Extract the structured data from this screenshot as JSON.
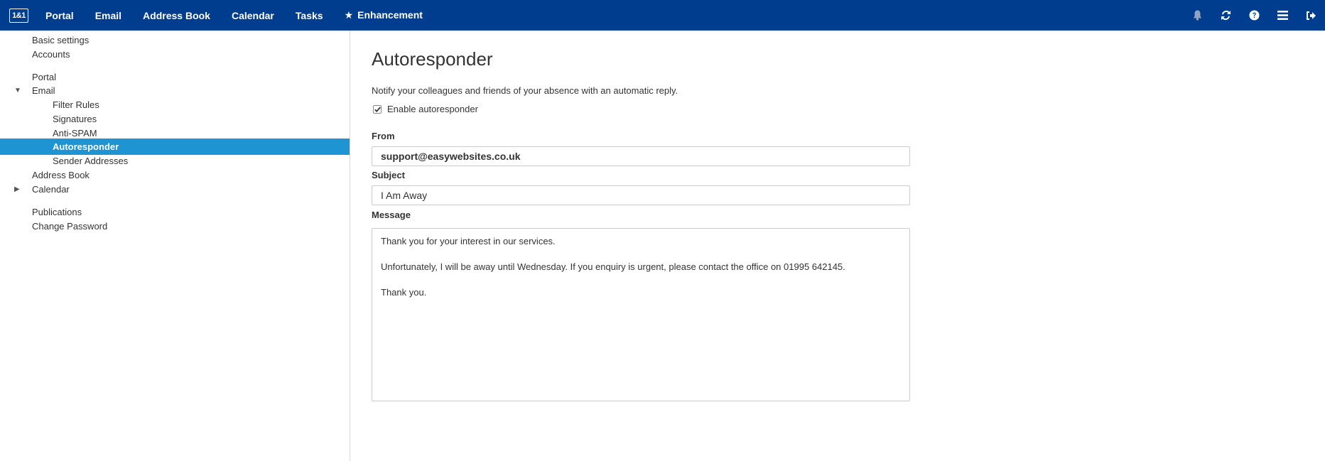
{
  "topbar": {
    "logo_text": "1&1",
    "nav": [
      {
        "label": "Portal"
      },
      {
        "label": "Email"
      },
      {
        "label": "Address Book"
      },
      {
        "label": "Calendar"
      },
      {
        "label": "Tasks"
      },
      {
        "label": "Enhancement",
        "icon": "star-icon"
      }
    ],
    "icons": [
      "bell-icon",
      "refresh-icon",
      "help-icon",
      "menu-icon",
      "logout-icon"
    ],
    "background_color": "#003d8f"
  },
  "sidebar": {
    "items": [
      {
        "label": "Basic settings"
      },
      {
        "label": "Accounts"
      },
      {
        "label": "Portal"
      },
      {
        "label": "Email",
        "expanded": true
      },
      {
        "label": "Filter Rules"
      },
      {
        "label": "Signatures"
      },
      {
        "label": "Anti-SPAM"
      },
      {
        "label": "Autoresponder",
        "active": true
      },
      {
        "label": "Sender Addresses"
      },
      {
        "label": "Address Book"
      },
      {
        "label": "Calendar",
        "expanded": false
      },
      {
        "label": "Publications"
      },
      {
        "label": "Change Password"
      }
    ],
    "active_color": "#1f94d2"
  },
  "main": {
    "title": "Autoresponder",
    "description": "Notify your colleagues and friends of your absence with an automatic reply.",
    "enable_label": "Enable autoresponder",
    "enable_checked": true,
    "from_label": "From",
    "from_value": "support@easywebsites.co.uk",
    "subject_label": "Subject",
    "subject_value": "I Am Away",
    "message_label": "Message",
    "message_lines": [
      "Thank you for your interest in our services.",
      "Unfortunately, I will be away until Wednesday. If you enquiry is urgent, please contact the office on 01995 642145.",
      "Thank you."
    ]
  }
}
